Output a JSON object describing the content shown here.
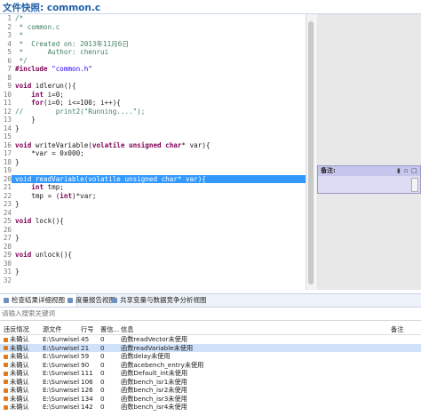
{
  "window_title": "文件快照: common.c",
  "code_lines": [
    {
      "n": "1",
      "parts": [
        {
          "t": "/*",
          "c": "comment"
        }
      ]
    },
    {
      "n": "2",
      "parts": [
        {
          "t": " * common.c",
          "c": "comment"
        }
      ]
    },
    {
      "n": "3",
      "parts": [
        {
          "t": " *",
          "c": "comment"
        }
      ]
    },
    {
      "n": "4",
      "parts": [
        {
          "t": " *  Created on: 2013年11月6日",
          "c": "comment"
        }
      ]
    },
    {
      "n": "5",
      "parts": [
        {
          "t": " *      Author: chenrui",
          "c": "comment"
        }
      ]
    },
    {
      "n": "6",
      "parts": [
        {
          "t": " */",
          "c": "comment"
        }
      ]
    },
    {
      "n": "7",
      "parts": [
        {
          "t": "#include ",
          "c": "kw"
        },
        {
          "t": "\"common.h\"",
          "c": "str"
        }
      ]
    },
    {
      "n": "8",
      "parts": []
    },
    {
      "n": "9",
      "parts": [
        {
          "t": "void ",
          "c": "kw"
        },
        {
          "t": "idlerun(){",
          "c": "plain"
        }
      ]
    },
    {
      "n": "10",
      "parts": [
        {
          "t": "    ",
          "c": "plain"
        },
        {
          "t": "int ",
          "c": "kw"
        },
        {
          "t": "i=0;",
          "c": "plain"
        }
      ]
    },
    {
      "n": "11",
      "parts": [
        {
          "t": "    ",
          "c": "plain"
        },
        {
          "t": "for",
          "c": "kw"
        },
        {
          "t": "(i=0; i<=100; i++){",
          "c": "plain"
        }
      ]
    },
    {
      "n": "12",
      "parts": [
        {
          "t": "//        print2(\"Running....\");",
          "c": "comment"
        }
      ]
    },
    {
      "n": "13",
      "parts": [
        {
          "t": "    }",
          "c": "plain"
        }
      ]
    },
    {
      "n": "14",
      "parts": [
        {
          "t": "}",
          "c": "plain"
        }
      ]
    },
    {
      "n": "15",
      "parts": []
    },
    {
      "n": "16",
      "parts": [
        {
          "t": "void ",
          "c": "kw"
        },
        {
          "t": "writeVariable(",
          "c": "plain"
        },
        {
          "t": "volatile unsigned char",
          "c": "kw"
        },
        {
          "t": "* var){",
          "c": "plain"
        }
      ]
    },
    {
      "n": "17",
      "parts": [
        {
          "t": "    *var = 0x000;",
          "c": "plain"
        }
      ]
    },
    {
      "n": "18",
      "parts": [
        {
          "t": "}",
          "c": "plain"
        }
      ]
    },
    {
      "n": "19",
      "parts": []
    },
    {
      "n": "20",
      "parts": [
        {
          "t": "void readVariable(volatile unsigned char* var){",
          "c": "plain"
        }
      ],
      "selected": true
    },
    {
      "n": "21",
      "parts": [
        {
          "t": "    ",
          "c": "plain"
        },
        {
          "t": "int ",
          "c": "kw"
        },
        {
          "t": "tmp;",
          "c": "plain"
        }
      ]
    },
    {
      "n": "22",
      "parts": [
        {
          "t": "    tmp = (",
          "c": "plain"
        },
        {
          "t": "int",
          "c": "kw"
        },
        {
          "t": ")*var;",
          "c": "plain"
        }
      ]
    },
    {
      "n": "23",
      "parts": [
        {
          "t": "}",
          "c": "plain"
        }
      ]
    },
    {
      "n": "24",
      "parts": []
    },
    {
      "n": "25",
      "parts": [
        {
          "t": "void ",
          "c": "kw"
        },
        {
          "t": "lock(){",
          "c": "plain"
        }
      ]
    },
    {
      "n": "26",
      "parts": []
    },
    {
      "n": "27",
      "parts": [
        {
          "t": "}",
          "c": "plain"
        }
      ]
    },
    {
      "n": "28",
      "parts": []
    },
    {
      "n": "29",
      "parts": [
        {
          "t": "void ",
          "c": "kw"
        },
        {
          "t": "unlock(){",
          "c": "plain"
        }
      ]
    },
    {
      "n": "30",
      "parts": []
    },
    {
      "n": "31",
      "parts": [
        {
          "t": "}",
          "c": "plain"
        }
      ]
    },
    {
      "n": "32",
      "parts": []
    }
  ],
  "note_panel": {
    "label": "备注:"
  },
  "tabs": [
    {
      "label": "检查结果详细视图",
      "active": true,
      "closable": true
    },
    {
      "label": "度量报告视图",
      "active": false,
      "closable": false
    },
    {
      "label": "共享变量与数据竞争分析视图",
      "active": false,
      "closable": false
    }
  ],
  "search": {
    "placeholder": "请输入搜索关键词"
  },
  "table": {
    "headers": [
      "违反情况",
      "源文件",
      "行号",
      "置信...",
      "信息",
      "备注"
    ],
    "rows": [
      {
        "status": "未确认",
        "file": "E:\\Sunwisel...",
        "line": "45",
        "conf": "0",
        "info": "函数readVector未使用",
        "note": "",
        "selected": false
      },
      {
        "status": "未确认",
        "file": "E:\\Sunwisel...",
        "line": "21",
        "conf": "0",
        "info": "函数readVariable未使用",
        "note": "",
        "selected": true
      },
      {
        "status": "未确认",
        "file": "E:\\Sunwisel...",
        "line": "59",
        "conf": "0",
        "info": "函数delay未使用",
        "note": "",
        "selected": false
      },
      {
        "status": "未确认",
        "file": "E:\\Sunwisel...",
        "line": "90",
        "conf": "0",
        "info": "函数acebench_entry未使用",
        "note": "",
        "selected": false
      },
      {
        "status": "未确认",
        "file": "E:\\Sunwisel...",
        "line": "111",
        "conf": "0",
        "info": "函数Default_int未使用",
        "note": "",
        "selected": false
      },
      {
        "status": "未确认",
        "file": "E:\\Sunwisel...",
        "line": "106",
        "conf": "0",
        "info": "函数bench_isr1未使用",
        "note": "",
        "selected": false
      },
      {
        "status": "未确认",
        "file": "E:\\Sunwisel...",
        "line": "126",
        "conf": "0",
        "info": "函数bench_isr2未使用",
        "note": "",
        "selected": false
      },
      {
        "status": "未确认",
        "file": "E:\\Sunwisel...",
        "line": "134",
        "conf": "0",
        "info": "函数bench_isr3未使用",
        "note": "",
        "selected": false
      },
      {
        "status": "未确认",
        "file": "E:\\Sunwisel...",
        "line": "142",
        "conf": "0",
        "info": "函数bench_isr4未使用",
        "note": "",
        "selected": false
      }
    ]
  }
}
